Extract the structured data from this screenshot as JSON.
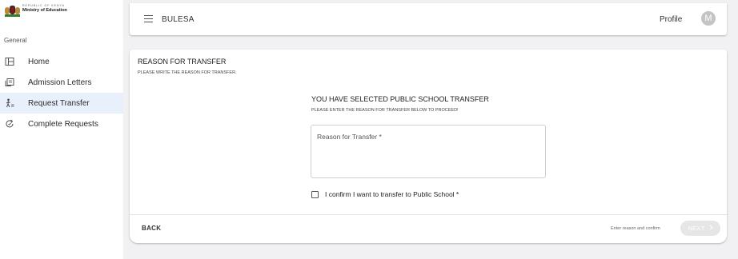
{
  "brand": {
    "line1": "REPUBLIC OF KENYA",
    "line2": "Ministry of Education",
    "line3": null
  },
  "sidebar": {
    "section_label": "General",
    "items": [
      {
        "label": "Home",
        "icon": "dashboard-icon",
        "active": false
      },
      {
        "label": "Admission Letters",
        "icon": "letters-icon",
        "active": false
      },
      {
        "label": "Request Transfer",
        "icon": "transfer-icon",
        "active": true
      },
      {
        "label": "Complete Requests",
        "icon": "refresh-icon",
        "active": false
      }
    ]
  },
  "header": {
    "menu_icon": "menu-icon",
    "title": "BULESA",
    "profile_label": "Profile",
    "avatar_initial": "M"
  },
  "form": {
    "title": "REASON FOR TRANSFER",
    "subtitle": "PLEASE WRITE THE REASON FOR TRANSFER.",
    "selection_title": "YOU HAVE SELECTED PUBLIC SCHOOL TRANSFER",
    "selection_subtitle": "PLEASE ENTER THE REASON FOR TRANSFER BELOW TO PROCEED!",
    "reason_placeholder": "Reason for Transfer *",
    "reason_value": "",
    "confirm_label": "I confirm I want to transfer to Public School *",
    "confirm_checked": false
  },
  "footer": {
    "back_label": "BACK",
    "hint": "Enter reason and confirm",
    "next_label": "NEXT",
    "next_icon": "chevron-right-icon",
    "next_enabled": false
  },
  "colors": {
    "active_nav_bg": "#e8f1fb",
    "page_bg": "#f1f1f3",
    "avatar_bg": "#c4c4c4",
    "next_disabled_bg": "#e6e6e6"
  }
}
